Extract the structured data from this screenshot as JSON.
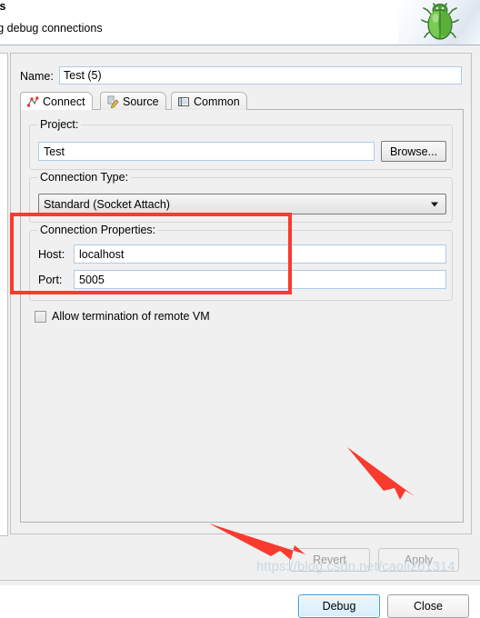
{
  "header": {
    "title": "ons",
    "subtitle": "ting debug connections",
    "icon": "green-bug-icon"
  },
  "name_field": {
    "label": "Name:",
    "value": "Test (5)",
    "placeholder": ""
  },
  "tabs": [
    {
      "label": "Connect",
      "icon": "connect-icon",
      "active": true
    },
    {
      "label": "Source",
      "icon": "source-icon",
      "active": false
    },
    {
      "label": "Common",
      "icon": "common-icon",
      "active": false
    }
  ],
  "project_group": {
    "title": "Project:",
    "value": "Test",
    "placeholder": "",
    "browse_label": "Browse..."
  },
  "connection_type_group": {
    "title": "Connection Type:",
    "selected": "Standard (Socket Attach)",
    "options": [
      "Standard (Socket Attach)"
    ]
  },
  "connection_properties_group": {
    "title": "Connection Properties:",
    "host_label": "Host:",
    "host_value": "localhost",
    "port_label": "Port:",
    "port_value": "5005"
  },
  "allow_termination": {
    "label": "Allow termination of remote VM",
    "checked": false
  },
  "buttons": {
    "revert": "Revert",
    "apply": "Apply",
    "debug": "Debug",
    "close": "Close"
  },
  "annotations": {
    "highlight_color": "#f93a2e",
    "arrow_color": "#f93a2e",
    "watermark": "https://blog.csdn.net/caoli201314"
  }
}
